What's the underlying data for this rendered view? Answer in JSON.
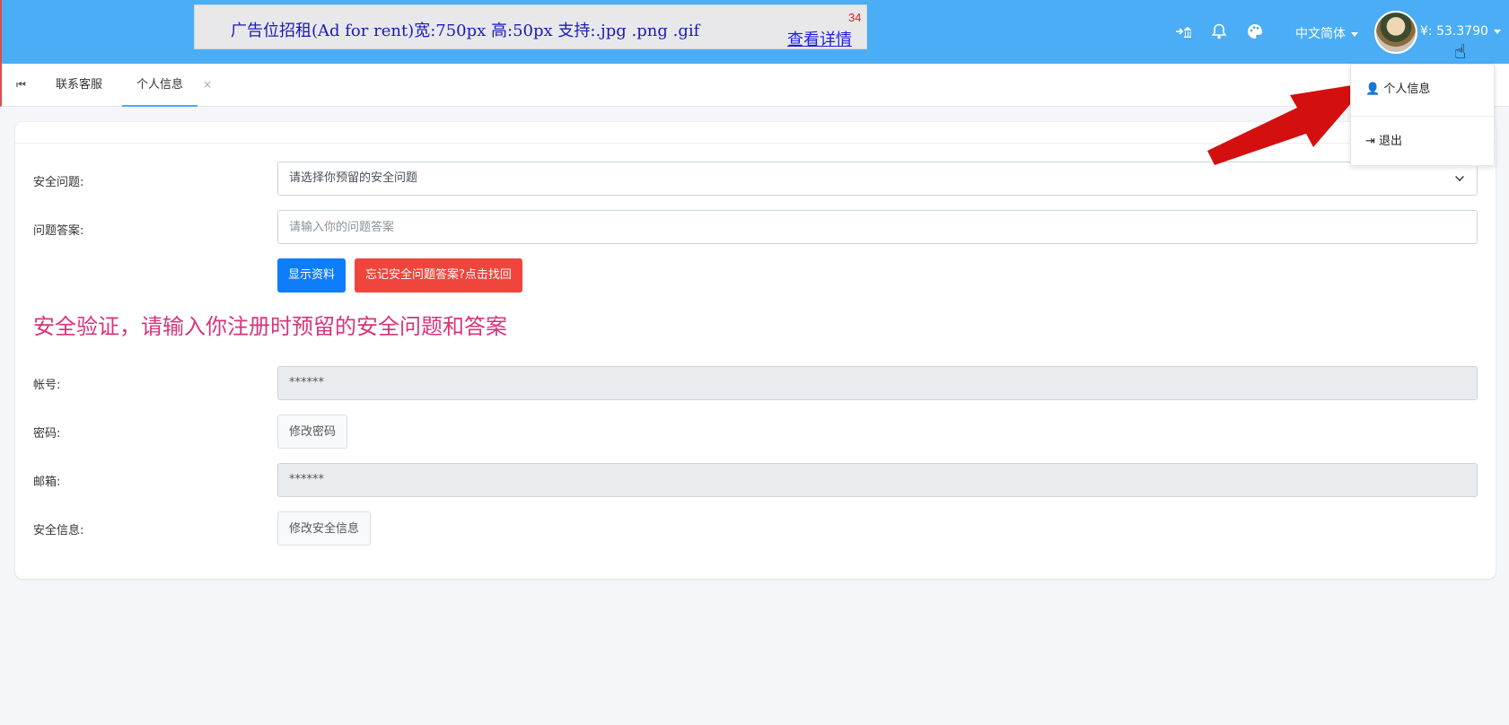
{
  "topbar": {
    "ad": {
      "text": "广告位招租(Ad for rent)宽:750px 高:50px 支持:.jpg .png .gif",
      "link": "查看详情",
      "count": "34"
    },
    "icons": [
      "login-arrow-icon",
      "bell-icon",
      "palette-icon"
    ],
    "language": "中文简体",
    "balance": "¥: 53.3790"
  },
  "tabs": {
    "first_icon": "skip-back-icon",
    "items": [
      {
        "label": "联系客服"
      },
      {
        "label": "个人信息"
      }
    ],
    "close": "×"
  },
  "form": {
    "security_question_label": "安全问题:",
    "security_question_value": "请选择你预留的安全问题",
    "answer_label": "问题答案:",
    "answer_placeholder": "请输入你的问题答案",
    "show_button": "显示资料",
    "forgot_button": "忘记安全问题答案?点击找回",
    "notice": "安全验证，请输入你注册时预留的安全问题和答案",
    "account_label": "帐号:",
    "account_value": "******",
    "password_label": "密码:",
    "password_button": "修改密码",
    "email_label": "邮箱:",
    "email_value": "******",
    "security_info_label": "安全信息:",
    "security_info_button": "修改安全信息"
  },
  "dropdown": {
    "profile": "个人信息",
    "logout": "退出"
  },
  "colors": {
    "topbar": "#4aadf5",
    "primary": "#0d7dfb",
    "danger": "#f0453c",
    "notice": "#d6347b",
    "arrow": "#d40f0f"
  }
}
